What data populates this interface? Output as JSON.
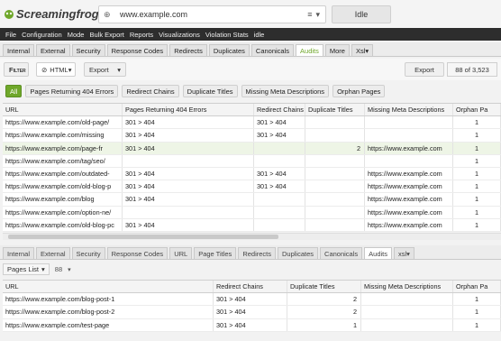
{
  "app": {
    "logo_text": "Screamingfrog",
    "url": "www.example.com",
    "status": "Idle"
  },
  "menu": [
    "File",
    "Configuration",
    "Mode",
    "Bulk Export",
    "Reports",
    "Visualizations",
    "Violation Stats",
    "idle"
  ],
  "top_tabs": [
    "Internal",
    "External",
    "Security",
    "Response Codes",
    "Redirects",
    "Duplicates",
    "Canonicals",
    "Audits",
    "More",
    "Xsl"
  ],
  "top_tab_active": "Audits",
  "filterbar": {
    "filter_label": "Filter",
    "html_label": "HTML",
    "export_label": "Export",
    "export_right_label": "Export",
    "count_text": "88 of 3,523"
  },
  "chips": [
    "All",
    "Pages Returning 404 Errors",
    "Redirect Chains",
    "Duplicate Titles",
    "Missing Meta Descriptions",
    "Orphan Pages"
  ],
  "main_table": {
    "columns": [
      "URL",
      "Pages Returning 404 Errors",
      "Redirect Chains",
      "Duplicate Titles",
      "Missing Meta Descriptions",
      "Orphan Pa"
    ],
    "rows": [
      [
        "https://www.example.com/old-page/",
        "301 > 404",
        "301 > 404",
        "",
        "",
        "1"
      ],
      [
        "https://www.example.com/missing",
        "301 > 404",
        "301 > 404",
        "",
        "",
        "1"
      ],
      [
        "https://www.example.com/page-fr",
        "301 > 404",
        "",
        "2",
        "https://www.example.com",
        "1"
      ],
      [
        "https://www.example.com/tag/seo/",
        "",
        "",
        "",
        "",
        "1"
      ],
      [
        "https://www.example.com/outdated-",
        "301 > 404",
        "301 > 404",
        "",
        "https://www.example.com",
        "1"
      ],
      [
        "https://www.example.com/old-blog-p",
        "301 > 404",
        "301 > 404",
        "",
        "https://www.example.com",
        "1"
      ],
      [
        "https://www.example.com/blog",
        "301 > 404",
        "",
        "",
        "https://www.example.com",
        "1"
      ],
      [
        "https://www.example.com/option-ne/",
        "",
        "",
        "",
        "https://www.example.com",
        "1"
      ],
      [
        "https://www.example.com/old-blog-pc",
        "301 > 404",
        "",
        "",
        "https://www.example.com",
        "1"
      ]
    ]
  },
  "bottom_tabs": [
    "Internal",
    "External",
    "Security",
    "Response Codes",
    "URL",
    "Page Titles",
    "Redirects",
    "Duplicates",
    "Canonicals",
    "Audits",
    "xsl"
  ],
  "bottom_tab_active": "Audits",
  "subfilter": {
    "label": "Pages List",
    "count": "88"
  },
  "bottom_table": {
    "columns": [
      "URL",
      "Redirect Chains",
      "Duplicate Titles",
      "Missing Meta Descriptions",
      "Orphan Pa"
    ],
    "rows": [
      [
        "https://www.example.com/blog-post-1",
        "301 > 404",
        "2",
        "",
        "1"
      ],
      [
        "https://www.example.com/blog-post-2",
        "301 > 404",
        "2",
        "",
        "1"
      ],
      [
        "https://www.example.com/test-page",
        "301 > 404",
        "1",
        "",
        "1"
      ]
    ]
  },
  "colors": {
    "accent": "#6fa72a",
    "menubar": "#2d2d2d"
  }
}
